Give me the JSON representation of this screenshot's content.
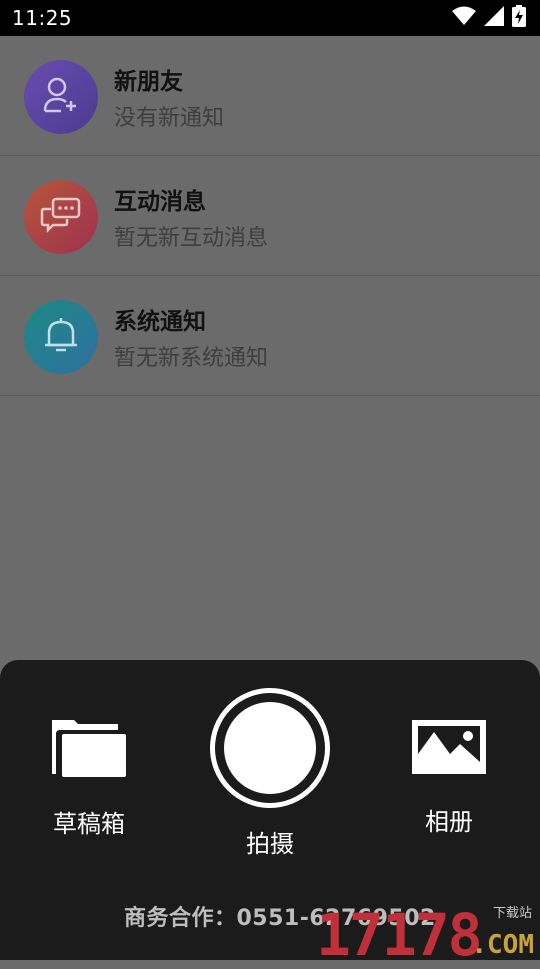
{
  "status_bar": {
    "time": "11:25",
    "icons": [
      "wifi-icon",
      "signal-icon",
      "battery-charging-icon"
    ]
  },
  "notifications": [
    {
      "title": "新朋友",
      "subtitle": "没有新通知",
      "icon": "add-friend-icon",
      "color": "#5a45a0"
    },
    {
      "title": "互动消息",
      "subtitle": "暂无新互动消息",
      "icon": "chat-bubble-icon",
      "color": "#a8424a"
    },
    {
      "title": "系统通知",
      "subtitle": "暂无新系统通知",
      "icon": "bell-icon",
      "color": "#247c93"
    }
  ],
  "sheet": {
    "drafts_label": "草稿箱",
    "shoot_label": "拍摄",
    "album_label": "相册",
    "business_text": "商务合作：0551-62769502"
  },
  "watermark": {
    "brand": "17178",
    "domain": ".COM",
    "tag": "下载站"
  }
}
